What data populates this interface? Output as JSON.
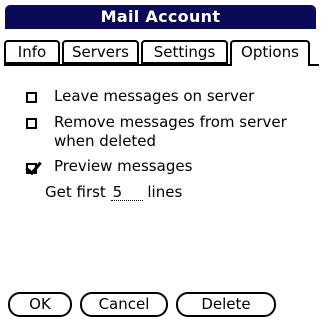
{
  "window": {
    "title": "Mail Account",
    "title_bar_color": "#0a0a55"
  },
  "tabs": [
    {
      "label": "Info",
      "active": false
    },
    {
      "label": "Servers",
      "active": false
    },
    {
      "label": "Settings",
      "active": false
    },
    {
      "label": "Options",
      "active": true
    }
  ],
  "options": {
    "leave_on_server": {
      "label": "Leave messages on server",
      "checked": false
    },
    "remove_from_server": {
      "label_line1": "Remove messages from server",
      "label_line2": "when deleted",
      "checked": false
    },
    "preview": {
      "label": "Preview messages",
      "checked": true
    },
    "get_first": {
      "prefix": "Get first",
      "value": "5",
      "suffix": "lines"
    }
  },
  "buttons": {
    "ok": "OK",
    "cancel": "Cancel",
    "delete": "Delete"
  }
}
